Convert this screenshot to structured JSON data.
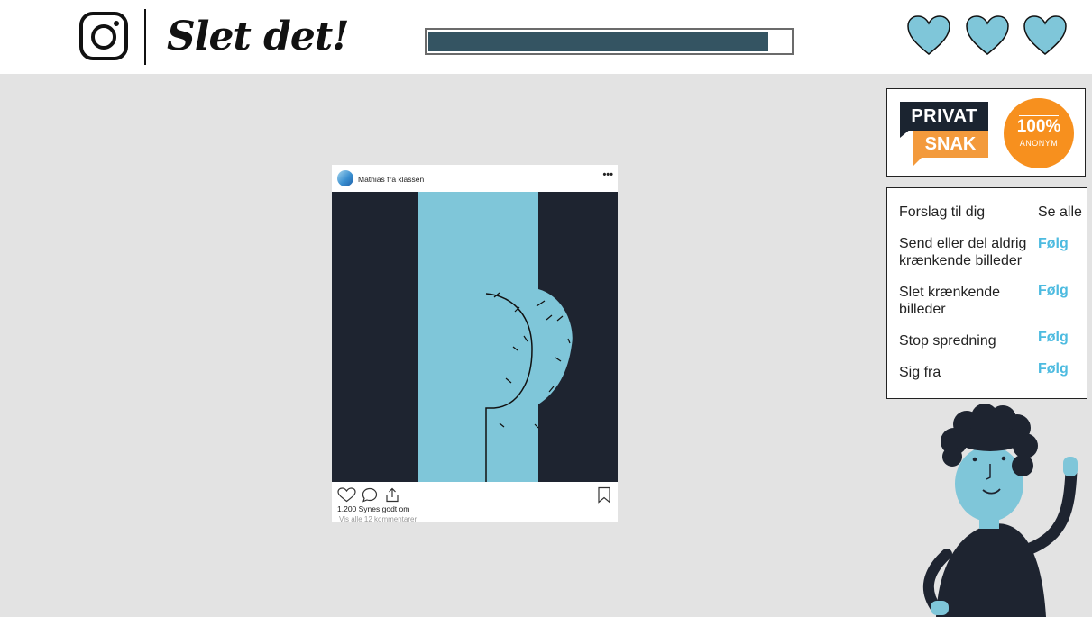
{
  "header": {
    "title": "Slet det!",
    "logo_icon": "instagram-icon",
    "progress": 0.94,
    "lives": [
      "heart-icon",
      "heart-icon",
      "heart-icon"
    ]
  },
  "promo": {
    "privat": "PRIVAT",
    "snak": "SNAK",
    "percent": "100%",
    "anonym": "ANONYM"
  },
  "suggestions": {
    "heading": "Forslag til dig",
    "see_all": "Se alle",
    "items": [
      {
        "text": "Send eller del aldrig krænkende billeder",
        "action": "Følg"
      },
      {
        "text": "Slet krænkende billeder",
        "action": "Følg"
      },
      {
        "text": "Stop spredning",
        "action": "Følg"
      },
      {
        "text": "Sig fra",
        "action": "Følg"
      }
    ]
  },
  "post": {
    "username": "Mathias fra klassen",
    "more": "•••",
    "likes": "1.200 Synes godt om",
    "comments": "Vis alle 12 kommentarer"
  },
  "colors": {
    "accent_blue": "#7fc6d9",
    "dark_navy": "#1e2430",
    "progress_fill": "#345462",
    "follow_blue": "#4dbbe0",
    "orange": "#f7901e"
  }
}
